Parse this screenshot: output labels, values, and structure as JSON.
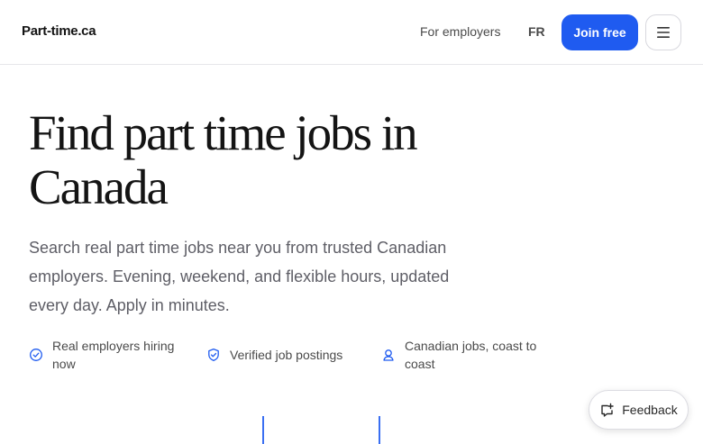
{
  "header": {
    "logo": "Part-time.ca",
    "nav_employers": "For employers",
    "nav_language": "FR",
    "join_label": "Join free",
    "menu_icon": "hamburger-menu-icon"
  },
  "hero": {
    "title": "Find part time jobs in Canada",
    "subtitle": "Search real part time jobs near you from trusted Canadian employers. Evening, weekend, and flexible hours, updated every day. Apply in minutes."
  },
  "features": [
    {
      "icon": "check-badge-icon",
      "text": "Real employers hiring now"
    },
    {
      "icon": "shield-check-icon",
      "text": "Verified job postings"
    },
    {
      "icon": "person-location-icon",
      "text": "Canadian jobs, coast to coast"
    }
  ],
  "feedback": {
    "label": "Feedback",
    "icon": "feedback-chat-icon"
  },
  "colors": {
    "accent": "#1f5bf0",
    "text_primary": "#141414",
    "text_secondary": "#5e5e66",
    "border": "#e6e6ea"
  }
}
